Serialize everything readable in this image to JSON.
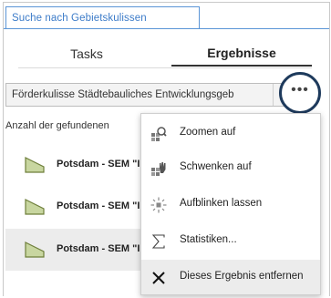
{
  "header": {
    "title": "Suche nach Gebietskulissen"
  },
  "tabs": [
    {
      "label": "Tasks",
      "active": false
    },
    {
      "label": "Ergebnisse",
      "active": true
    }
  ],
  "layer_select": {
    "value": "Förderkulisse Städtebauliches Entwicklungsgeb"
  },
  "more_button": {
    "label": "•••"
  },
  "results_count_label": "Anzahl der gefundenen",
  "results": [
    {
      "label": "Potsdam - SEM \"I"
    },
    {
      "label": "Potsdam - SEM \"I"
    },
    {
      "label": "Potsdam - SEM \"I"
    }
  ],
  "menu": {
    "items": [
      {
        "label": "Zoomen auf",
        "icon": "zoom-to-icon"
      },
      {
        "label": "Schwenken auf",
        "icon": "pan-to-icon"
      },
      {
        "label": "Aufblinken lassen",
        "icon": "flash-icon"
      },
      {
        "label": "Statistiken...",
        "icon": "sigma-icon"
      },
      {
        "label": "Dieses Ergebnis entfernen",
        "icon": "close-icon"
      }
    ]
  },
  "colors": {
    "accent": "#3d7cc9",
    "polygon_fill": "#c8d6a0",
    "polygon_stroke": "#6e7f3a",
    "highlight_ring": "#1e3a5c"
  }
}
